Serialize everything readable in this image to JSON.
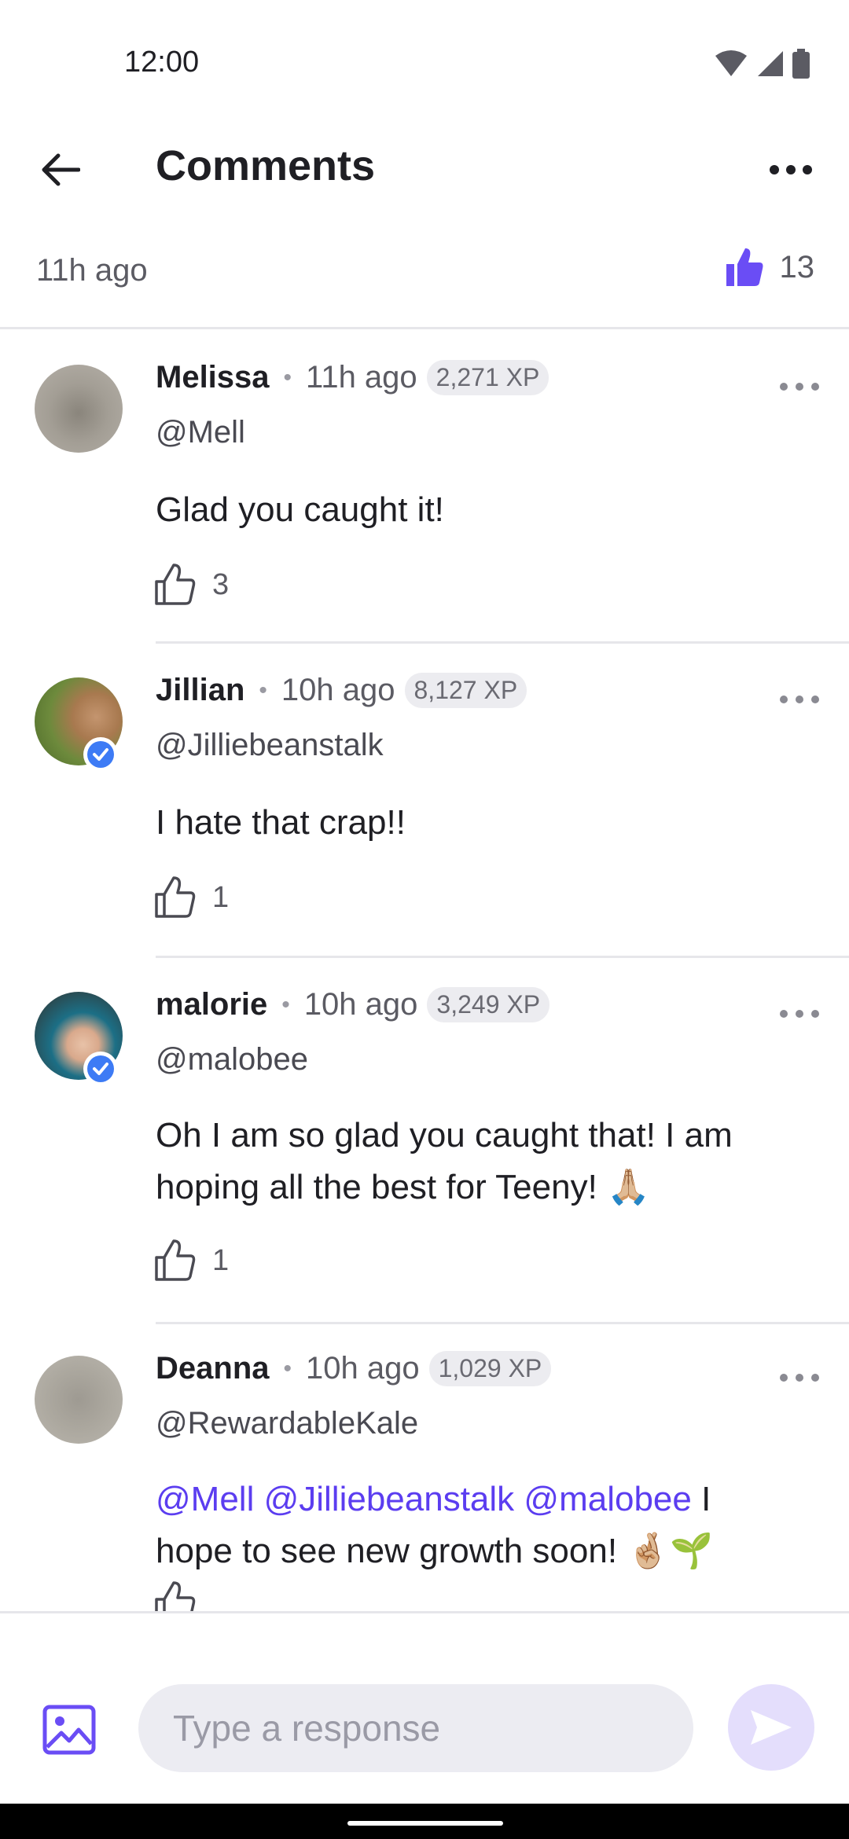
{
  "status_bar": {
    "time": "12:00"
  },
  "header": {
    "title": "Comments"
  },
  "post": {
    "time": "11h ago",
    "like_count": "13"
  },
  "comments": [
    {
      "name": "Melissa",
      "time": "11h ago",
      "xp": "2,271 XP",
      "handle": "@Mell",
      "body": "Glad you caught it!",
      "likes": "3"
    },
    {
      "name": "Jillian",
      "time": "10h ago",
      "xp": "8,127 XP",
      "handle": "@Jilliebeanstalk",
      "body": "I hate that crap!!",
      "likes": "1"
    },
    {
      "name": "malorie",
      "time": "10h ago",
      "xp": "3,249 XP",
      "handle": "@malobee",
      "body": "Oh I am so glad you caught that! I am hoping all the best for Teeny! 🙏🏼",
      "likes": "1"
    },
    {
      "name": "Deanna",
      "time": "10h ago",
      "xp": "1,029 XP",
      "handle": "@RewardableKale",
      "mentions": [
        "@Mell",
        "@Jilliebeanstalk",
        "@malobee"
      ],
      "body": "I hope to see new growth soon! 🤞🏼🌱"
    }
  ],
  "composer": {
    "placeholder": "Type a response"
  },
  "colors": {
    "accent": "#6a4df5",
    "mention": "#5b3df0",
    "verified": "#3d7bf5"
  }
}
